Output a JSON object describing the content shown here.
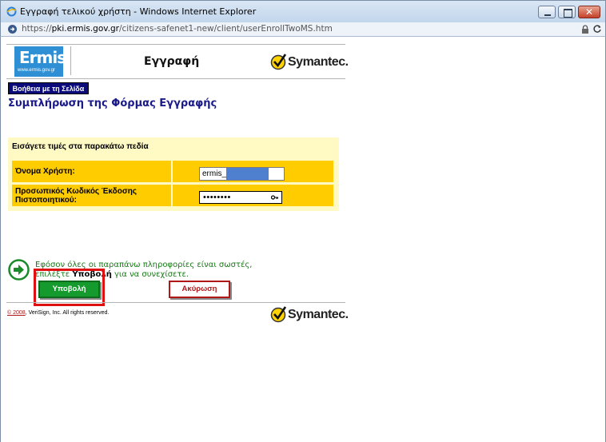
{
  "window": {
    "title": "Εγγραφή τελικού χρήστη - Windows Internet Explorer",
    "close_glyph": "✕"
  },
  "addressbar": {
    "url_prefix": "https://",
    "url_domain": "pki.ermis.gov.gr",
    "url_path": "/citizens-safenet1-new/client/userEnrollTwoMS.htm"
  },
  "header": {
    "logo_text": "Ermis",
    "logo_subtext": "www.ermis.gov.gr",
    "title": "Εγγραφή",
    "brand": "Symantec."
  },
  "help_button": "Βοήθεια με τη Σελίδα",
  "form_heading": "Συμπλήρωση της Φόρμας Εγγραφής",
  "form": {
    "instruction": "Εισάγετε τιμές στα παρακάτω πεδία",
    "username_label": "Όνομα Χρήστη:",
    "username_value": "ermis_",
    "password_label": "Προσωπικός Κωδικός Έκδοσης Πιστοποιητικού:",
    "password_value": "••••••••"
  },
  "info": {
    "line1": "Εφόσον όλες οι παραπάνω πληροφορίες είναι σωστές,",
    "line2_prefix": "επιλέξτε ",
    "line2_bold": "Υποβολή",
    "line2_suffix": " για να συνεχίσετε."
  },
  "buttons": {
    "submit": "Υποβολή",
    "cancel": "Ακύρωση"
  },
  "footer": {
    "year": "© 2008",
    "rest": ", VeriSign, Inc. All rights reserved.",
    "brand": "Symantec."
  },
  "colors": {
    "form_bg": "#fff9c4",
    "row_bg": "#ffcc00",
    "submit_green": "#159a2e",
    "cancel_red": "#b01818",
    "heading_blue": "#1a1a8a",
    "highlight_red": "#e01010"
  }
}
